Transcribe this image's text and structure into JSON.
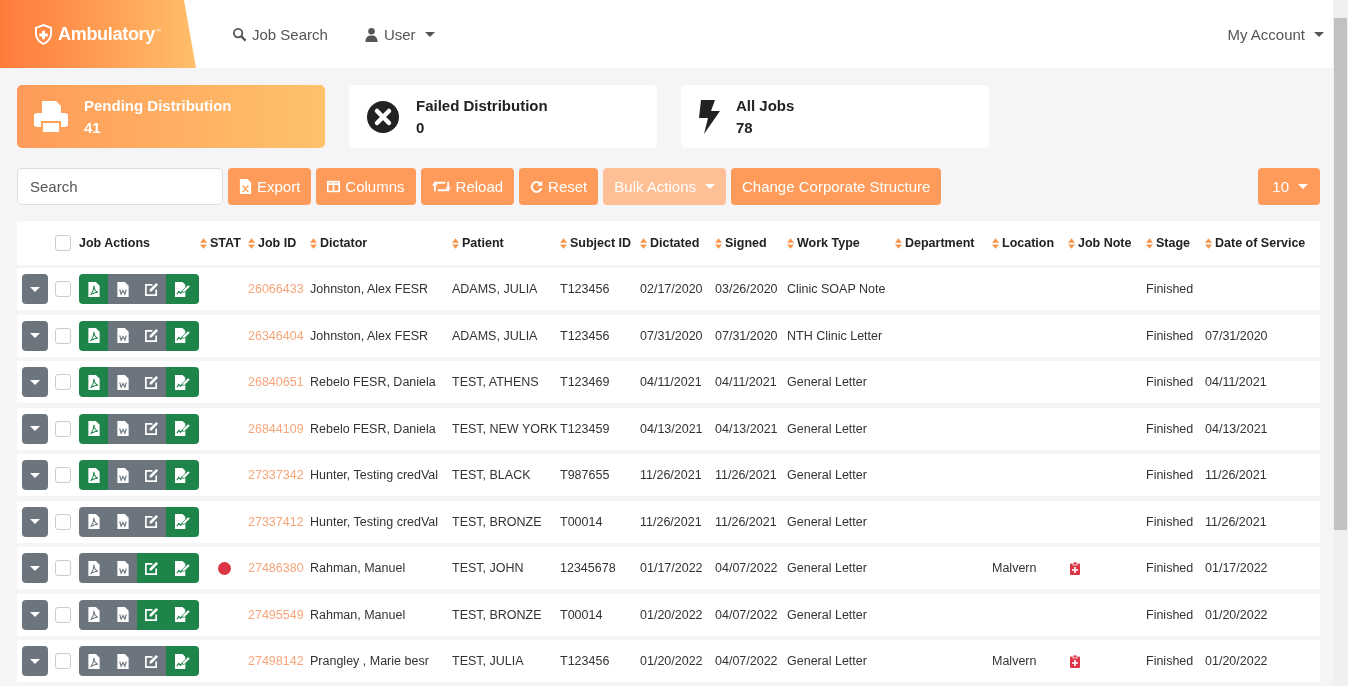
{
  "brand": {
    "logo": "Ambulatory$^{™}$"
  },
  "nav": [
    {
      "label": "Job Search",
      "kind": "search"
    },
    {
      "label": "User",
      "kind": "user"
    }
  ],
  "account": {
    "label": "My Account"
  },
  "stats": [
    {
      "title": "Pending Distribution",
      "count": "41",
      "kind": "printer",
      "selected": true
    },
    {
      "title": "Failed Distribution",
      "count": "0",
      "kind": "failed",
      "selected": false
    },
    {
      "title": "All Jobs",
      "count": "78",
      "kind": "bolt",
      "selected": false
    }
  ],
  "search": {
    "placeholder": "Search"
  },
  "toolbar": [
    {
      "label": "Export",
      "kind": "export",
      "disabled": false
    },
    {
      "label": "Columns",
      "kind": "columns",
      "disabled": false
    },
    {
      "label": "Reload",
      "kind": "reload",
      "disabled": false
    },
    {
      "label": "Reset",
      "kind": "reset",
      "disabled": false
    },
    {
      "label": "Bulk Actions",
      "kind": "dropdown",
      "disabled": true
    },
    {
      "label": "Change Corporate Structure",
      "kind": "plain",
      "disabled": false
    }
  ],
  "page_size": {
    "label": "10"
  },
  "table": {
    "select_all": {
      "checked": false
    },
    "columns": [
      {
        "label": "Job Actions",
        "sortable": false
      },
      {
        "label": "STAT",
        "sortable": true
      },
      {
        "label": "Job ID",
        "sortable": true
      },
      {
        "label": "Dictator",
        "sortable": true
      },
      {
        "label": "Patient",
        "sortable": true
      },
      {
        "label": "Subject ID",
        "sortable": true
      },
      {
        "label": "Dictated",
        "sortable": true
      },
      {
        "label": "Signed",
        "sortable": true
      },
      {
        "label": "Work Type",
        "sortable": true
      },
      {
        "label": "Department",
        "sortable": true
      },
      {
        "label": "Location",
        "sortable": true
      },
      {
        "label": "Job Note",
        "sortable": true
      },
      {
        "label": "Stage",
        "sortable": true
      },
      {
        "label": "Date of Service",
        "sortable": true
      }
    ],
    "rows": [
      {
        "checked": false,
        "pdf": true,
        "word": false,
        "edit": false,
        "sign": true,
        "stat": false,
        "job_id": "26066433",
        "dictator": "Johnston, Alex FESR",
        "patient": "ADAMS, JULIA",
        "subject_id": "T123456",
        "dictated": "02/17/2020",
        "signed": "03/26/2020",
        "work_type": "Clinic SOAP Note",
        "location": "",
        "note": false,
        "stage": "Finished",
        "date_of_service": ""
      },
      {
        "checked": false,
        "pdf": true,
        "word": false,
        "edit": false,
        "sign": true,
        "stat": false,
        "job_id": "26346404",
        "dictator": "Johnston, Alex FESR",
        "patient": "ADAMS, JULIA",
        "subject_id": "T123456",
        "dictated": "07/31/2020",
        "signed": "07/31/2020",
        "work_type": "NTH Clinic Letter",
        "location": "",
        "note": false,
        "stage": "Finished",
        "date_of_service": "07/31/2020"
      },
      {
        "checked": false,
        "pdf": true,
        "word": false,
        "edit": false,
        "sign": true,
        "stat": false,
        "job_id": "26840651",
        "dictator": "Rebelo FESR, Daniela",
        "patient": "TEST, ATHENS",
        "subject_id": "T123469",
        "dictated": "04/11/2021",
        "signed": "04/11/2021",
        "work_type": "General Letter",
        "location": "",
        "note": false,
        "stage": "Finished",
        "date_of_service": "04/11/2021"
      },
      {
        "checked": false,
        "pdf": true,
        "word": false,
        "edit": false,
        "sign": true,
        "stat": false,
        "job_id": "26844109",
        "dictator": "Rebelo FESR, Daniela",
        "patient": "TEST, NEW YORK",
        "subject_id": "T123459",
        "dictated": "04/13/2021",
        "signed": "04/13/2021",
        "work_type": "General Letter",
        "location": "",
        "note": false,
        "stage": "Finished",
        "date_of_service": "04/13/2021"
      },
      {
        "checked": false,
        "pdf": true,
        "word": false,
        "edit": false,
        "sign": true,
        "stat": false,
        "job_id": "27337342",
        "dictator": "Hunter, Testing credVal",
        "patient": "TEST, BLACK",
        "subject_id": "T987655",
        "dictated": "11/26/2021",
        "signed": "11/26/2021",
        "work_type": "General Letter",
        "location": "",
        "note": false,
        "stage": "Finished",
        "date_of_service": "11/26/2021"
      },
      {
        "checked": false,
        "pdf": false,
        "word": false,
        "edit": false,
        "sign": true,
        "stat": false,
        "job_id": "27337412",
        "dictator": "Hunter, Testing credVal",
        "patient": "TEST, BRONZE",
        "subject_id": "T00014",
        "dictated": "11/26/2021",
        "signed": "11/26/2021",
        "work_type": "General Letter",
        "location": "",
        "note": false,
        "stage": "Finished",
        "date_of_service": "11/26/2021"
      },
      {
        "checked": false,
        "pdf": false,
        "word": false,
        "edit": true,
        "sign": true,
        "stat": true,
        "job_id": "27486380",
        "dictator": "Rahman, Manuel",
        "patient": "TEST, JOHN",
        "subject_id": "12345678",
        "dictated": "01/17/2022",
        "signed": "04/07/2022",
        "work_type": "General Letter",
        "location": "Malvern",
        "note": true,
        "stage": "Finished",
        "date_of_service": "01/17/2022"
      },
      {
        "checked": false,
        "pdf": false,
        "word": false,
        "edit": true,
        "sign": true,
        "stat": false,
        "job_id": "27495549",
        "dictator": "Rahman, Manuel",
        "patient": "TEST, BRONZE",
        "subject_id": "T00014",
        "dictated": "01/20/2022",
        "signed": "04/07/2022",
        "work_type": "General Letter",
        "location": "",
        "note": false,
        "stage": "Finished",
        "date_of_service": "01/20/2022"
      },
      {
        "checked": false,
        "pdf": false,
        "word": false,
        "edit": false,
        "sign": true,
        "stat": false,
        "job_id": "27498142",
        "dictator": "Prangley , Marie besr",
        "patient": "TEST, JULIA",
        "subject_id": "T123456",
        "dictated": "01/20/2022",
        "signed": "04/07/2022",
        "work_type": "General Letter",
        "location": "Malvern",
        "note": true,
        "stage": "Finished",
        "date_of_service": "01/20/2022"
      }
    ]
  }
}
